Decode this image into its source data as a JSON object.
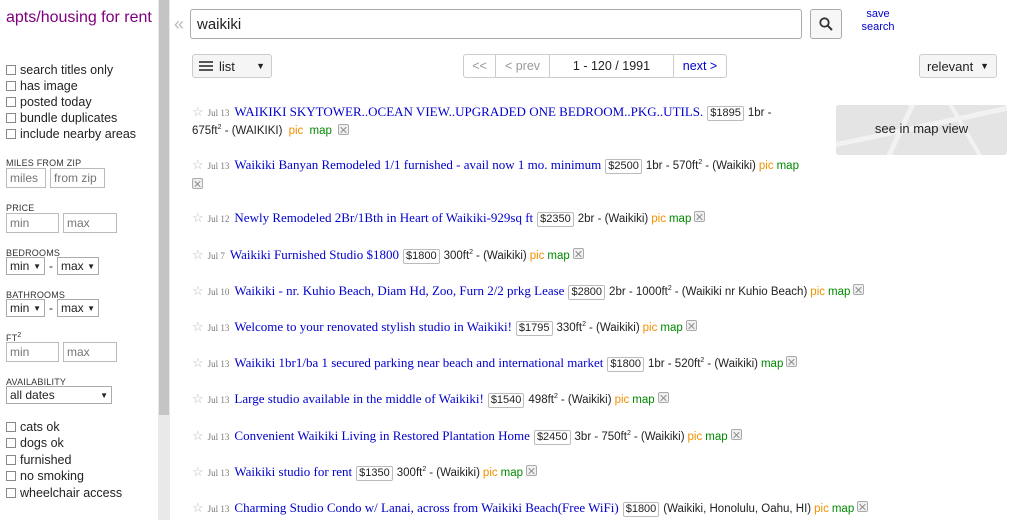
{
  "sidebar": {
    "category_title": "apts/housing for rent",
    "filters_top": [
      "search titles only",
      "has image",
      "posted today",
      "bundle duplicates",
      "include nearby areas"
    ],
    "miles_label": "MILES FROM ZIP",
    "miles_placeholder": "miles",
    "zip_placeholder": "from zip",
    "price_label": "PRICE",
    "min_placeholder": "min",
    "max_placeholder": "max",
    "bedrooms_label": "BEDROOMS",
    "bathrooms_label": "BATHROOMS",
    "sel_min": "min",
    "sel_max": "max",
    "dash": "-",
    "ft_label": "FT",
    "ft_sup": "2",
    "availability_label": "AVAILABILITY",
    "availability_value": "all dates",
    "filters_bottom": [
      "cats ok",
      "dogs ok",
      "furnished",
      "no smoking",
      "wheelchair access"
    ]
  },
  "search": {
    "query": "waikiki",
    "save_line1": "save",
    "save_line2": "search"
  },
  "toolbar": {
    "view": "list",
    "first": "<<",
    "prev": "< prev",
    "range": "1 - 120 / 1991",
    "next": "next >",
    "sort": "relevant"
  },
  "map": {
    "label": "see in map view"
  },
  "results": [
    {
      "date": "Jul 13",
      "title": "WAIKIKI SKYTOWER..OCEAN VIEW..UPGRADED ONE BEDROOM..PKG..UTILS.",
      "price": "$1895",
      "meta1": "1br -",
      "meta2": "675ft",
      "loc": "- (WAIKIKI)",
      "pic": "pic",
      "map": "map"
    },
    {
      "date": "Jul 13",
      "title": "Waikiki Banyan Remodeled 1/1 furnished - avail now 1 mo. minimum",
      "price": "$2500",
      "meta": "1br - 570ft",
      "loc": "- (Waikiki)",
      "pic": "pic",
      "map": "map"
    },
    {
      "date": "Jul 12",
      "title": "Newly Remodeled 2Br/1Bth in Heart of Waikiki-929sq ft",
      "price": "$2350",
      "meta": "2br - (Waikiki)",
      "pic": "pic",
      "map": "map"
    },
    {
      "date": "Jul 7",
      "title": "Waikiki Furnished Studio $1800",
      "price": "$1800",
      "meta": "300ft",
      "loc": "- (Waikiki)",
      "pic": "pic",
      "map": "map"
    },
    {
      "date": "Jul 10",
      "title": "Waikiki - nr. Kuhio Beach, Diam Hd, Zoo, Furn 2/2 prkg Lease",
      "price": "$2800",
      "meta": "2br - 1000ft",
      "loc": "- (Waikiki nr Kuhio Beach)",
      "pic": "pic",
      "map": "map"
    },
    {
      "date": "Jul 13",
      "title": "Welcome to your renovated stylish studio in Waikiki!",
      "price": "$1795",
      "meta": "330ft",
      "loc": "- (Waikiki)",
      "pic": "pic",
      "map": "map"
    },
    {
      "date": "Jul 13",
      "title": "Waikiki 1br1/ba 1 secured parking near beach and international market",
      "price": "$1800",
      "meta": "1br - 520ft",
      "loc": "- (Waikiki)",
      "map": "map"
    },
    {
      "date": "Jul 13",
      "title": "Large studio available in the middle of Waikiki!",
      "price": "$1540",
      "meta": "498ft",
      "loc": "- (Waikiki)",
      "pic": "pic",
      "map": "map"
    },
    {
      "date": "Jul 13",
      "title": "Convenient Waikiki Living in Restored Plantation Home",
      "price": "$2450",
      "meta": "3br - 750ft",
      "loc": "- (Waikiki)",
      "pic": "pic",
      "map": "map"
    },
    {
      "date": "Jul 13",
      "title": "Waikiki studio for rent",
      "price": "$1350",
      "meta": "300ft",
      "loc": "- (Waikiki)",
      "pic": "pic",
      "map": "map"
    },
    {
      "date": "Jul 13",
      "title": "Charming Studio Condo w/ Lanai, across from Waikiki Beach(Free WiFi)",
      "price": "$1800",
      "meta": "(Waikiki, Honolulu, Oahu, HI)",
      "pic": "pic",
      "map": "map"
    }
  ],
  "sup2": "2",
  "colors": {
    "link": "#0000cc",
    "category": "#800080",
    "pic": "#f29000",
    "map": "#008800"
  }
}
